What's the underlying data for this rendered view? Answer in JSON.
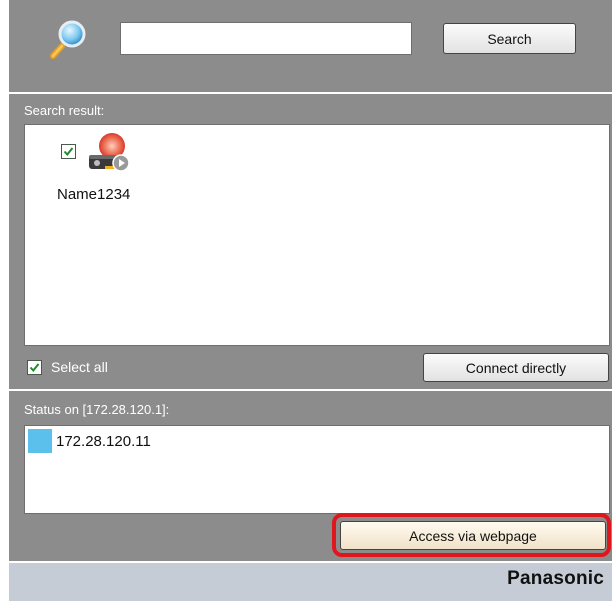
{
  "search": {
    "input_value": "",
    "button_label": "Search"
  },
  "results": {
    "label": "Search result:",
    "items": [
      {
        "name": "Name1234",
        "checked": true
      }
    ],
    "select_all_label": "Select all",
    "select_all_checked": true,
    "connect_button_label": "Connect directly"
  },
  "status": {
    "label": "Status on [172.28.120.1]:",
    "items": [
      {
        "ip": "172.28.120.11",
        "color": "#5bc0ec"
      }
    ],
    "access_button_label": "Access via webpage",
    "highlight_color": "#e0161d"
  },
  "footer": {
    "brand": "Panasonic"
  },
  "icons": {
    "search": "magnifier-icon",
    "device": "projector-device-icon",
    "checkbox": "checkmark-icon"
  }
}
